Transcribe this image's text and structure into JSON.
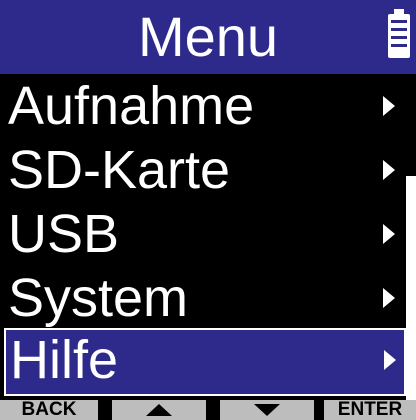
{
  "header": {
    "title": "Menu"
  },
  "menu": {
    "items": [
      {
        "label": "Aufnahme"
      },
      {
        "label": "SD-Karte"
      },
      {
        "label": "USB"
      },
      {
        "label": "System"
      },
      {
        "label": "Hilfe",
        "selected": true
      }
    ]
  },
  "footer": {
    "back_label": "BACK",
    "up_icon": "up-arrow-icon",
    "down_icon": "down-arrow-icon",
    "enter_label": "ENTER"
  },
  "colors": {
    "accent": "#2e2a8c",
    "text": "#ffffff",
    "background": "#000000",
    "footer_button": "#bdbdbd"
  }
}
